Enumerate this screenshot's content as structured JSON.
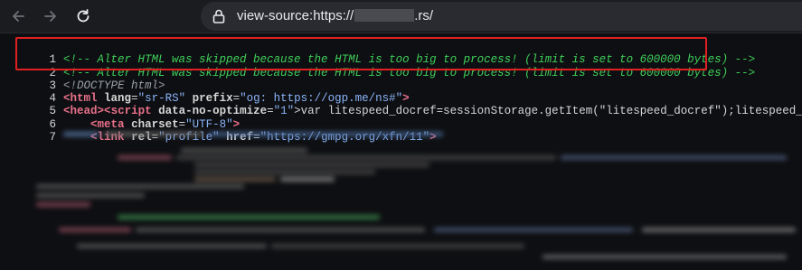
{
  "toolbar": {
    "back_icon": "arrow-left-icon",
    "forward_icon": "arrow-right-icon",
    "reload_icon": "reload-icon",
    "lock_icon": "lock-icon",
    "url_prefix": "view-source:https://",
    "url_suffix": ".rs/"
  },
  "source": {
    "lines": [
      {
        "num": "1",
        "comment": "<!-- Alter HTML was skipped because the HTML is too big to process! (limit is set to 600000 bytes) -->"
      },
      {
        "num": "2",
        "comment": "<!-- Alter HTML was skipped because the HTML is too big to process! (limit is set to 600000 bytes) -->"
      },
      {
        "num": "3",
        "doctype": "<!DOCTYPE html>"
      },
      {
        "num": "4",
        "open": "<",
        "tag": "html",
        "attr1": " lang",
        "eq1": "=",
        "val1": "\"sr-RS\"",
        "attr2": " prefix",
        "eq2": "=",
        "val2": "\"og: https://ogp.me/ns#\"",
        "close": ">"
      },
      {
        "num": "5",
        "open": "<",
        "tag": "head",
        "mid": "><",
        "tag2": "script",
        "attr1": " data-no-optimize",
        "eq1": "=",
        "val1": "\"1\"",
        "rest": ">var litespeed_docref=sessionStorage.getItem(\"litespeed_docref\");litespeed_docref&&(O"
      },
      {
        "num": "6",
        "indent": "    ",
        "open": "<",
        "tag": "meta",
        "attr1": " charset",
        "eq1": "=",
        "val1": "\"UTF-8\"",
        "close": ">"
      },
      {
        "num": "7",
        "indent": "    ",
        "open": "<",
        "tag": "link",
        "attr1": " rel",
        "eq1": "=",
        "val1": "\"profile\"",
        "attr2": " href",
        "eq2": "=",
        "val2": "\"https://gmpg.org/xfn/11\"",
        "close": ">"
      }
    ]
  },
  "colors": {
    "highlight_border": "#e02020",
    "comment": "#3ecf5a",
    "tag": "#e8718a",
    "value": "#8ab4f8"
  }
}
